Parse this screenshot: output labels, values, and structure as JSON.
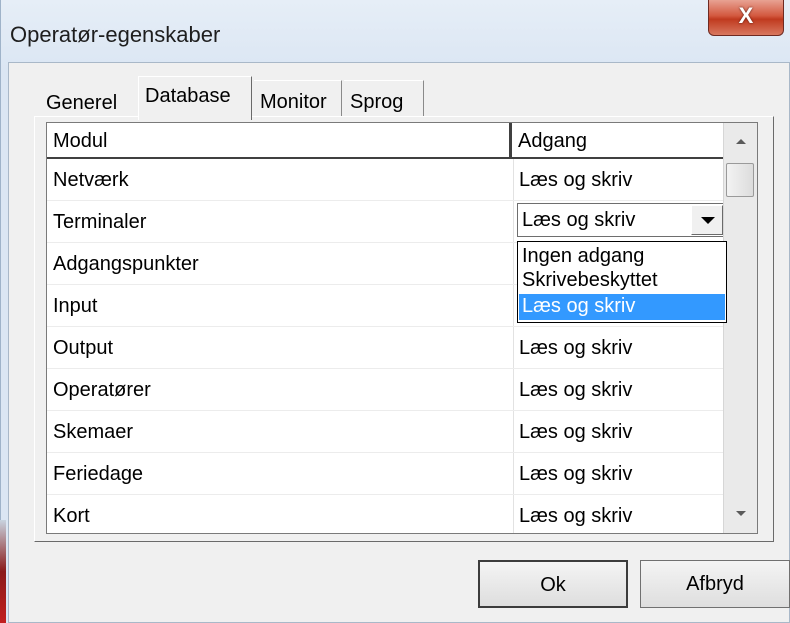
{
  "window": {
    "title": "Operatør-egenskaber",
    "close_glyph": "X"
  },
  "tabs": [
    {
      "label": "Generel"
    },
    {
      "label": "Database"
    },
    {
      "label": "Monitor"
    },
    {
      "label": "Sprog"
    }
  ],
  "grid": {
    "columns": [
      "Modul",
      "Adgang"
    ],
    "rows": [
      {
        "modul": "Netværk",
        "adgang": "Læs og skriv"
      },
      {
        "modul": "Terminaler",
        "adgang": "Læs og skriv"
      },
      {
        "modul": "Adgangspunkter",
        "adgang": ""
      },
      {
        "modul": "Input",
        "adgang": ""
      },
      {
        "modul": "Output",
        "adgang": "Læs og skriv"
      },
      {
        "modul": "Operatører",
        "adgang": "Læs og skriv"
      },
      {
        "modul": "Skemaer",
        "adgang": "Læs og skriv"
      },
      {
        "modul": "Feriedage",
        "adgang": "Læs og skriv"
      },
      {
        "modul": "Kort",
        "adgang": "Læs og skriv"
      }
    ],
    "dropdown_options": [
      "Ingen adgang",
      "Skrivebeskyttet",
      "Læs og skriv"
    ]
  },
  "buttons": {
    "ok": "Ok",
    "cancel": "Afbryd"
  },
  "colors": {
    "selection": "#3399ff",
    "close": "#c7472a"
  }
}
